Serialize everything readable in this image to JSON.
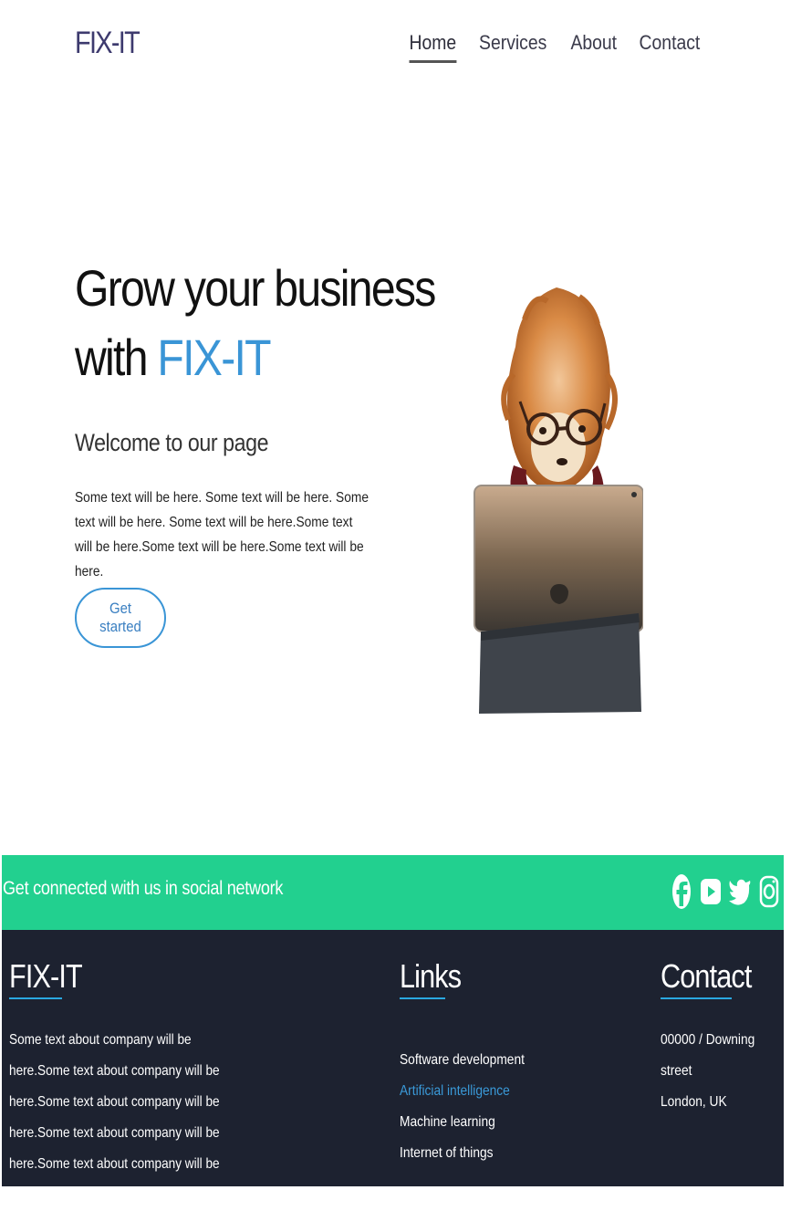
{
  "nav": {
    "brand": "FIX-IT",
    "items": [
      {
        "label": "Home",
        "active": true
      },
      {
        "label": "Services",
        "active": false
      },
      {
        "label": "About",
        "active": false
      },
      {
        "label": "Contact",
        "active": false
      }
    ]
  },
  "hero": {
    "title_line1": "Grow your business",
    "title_line2_prefix": "with ",
    "title_accent": "FIX-IT",
    "subtitle": "Welcome to our page",
    "text": "Some text will be here. Some text will be here. Some text will be here. Some text will be here.Some text will be here.Some text will be here.Some text will be here.",
    "button_label": "Get started",
    "image_icon": "dog-with-tablet-image"
  },
  "social": {
    "text": "Get connected with us in social network",
    "icons": [
      "facebook-icon",
      "youtube-icon",
      "twitter-icon",
      "instagram-icon"
    ]
  },
  "footer": {
    "about": {
      "heading": "FIX-IT",
      "text": "Some text about company will be here.Some text about company will be here.Some text about company will be here.Some text about company will be here.Some text about company will be here."
    },
    "links": {
      "heading": "Links",
      "items": [
        "Software development",
        "Artificial intelligence",
        "Machine learning",
        "Internet of things"
      ]
    },
    "contact": {
      "heading": "Contact",
      "line1": "00000 / Downing street",
      "line2": "London, UK"
    }
  },
  "colors": {
    "accent": "#3a95d6",
    "social_bar": "#22d08f",
    "footer_bg": "#1d2230",
    "brand": "#3d3a6e"
  }
}
